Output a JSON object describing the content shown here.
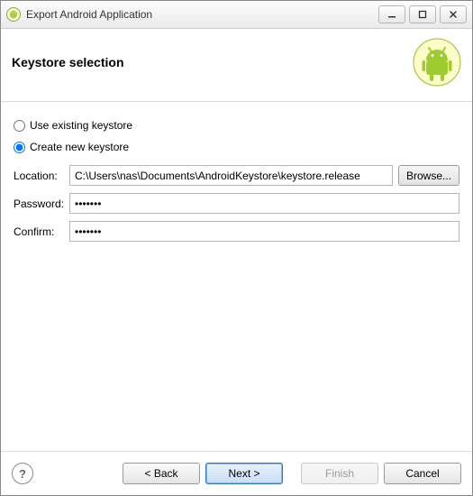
{
  "window": {
    "title": "Export Android Application"
  },
  "banner": {
    "title": "Keystore selection"
  },
  "radios": {
    "use_existing_label": "Use existing keystore",
    "create_new_label": "Create new keystore",
    "selected": "create"
  },
  "fields": {
    "location_label": "Location:",
    "location_value": "C:\\Users\\nas\\Documents\\AndroidKeystore\\keystore.release",
    "browse_label": "Browse...",
    "password_label": "Password:",
    "password_value": "•••••••",
    "confirm_label": "Confirm:",
    "confirm_value": "•••••••"
  },
  "footer": {
    "back_label": "< Back",
    "next_label": "Next >",
    "finish_label": "Finish",
    "cancel_label": "Cancel"
  }
}
